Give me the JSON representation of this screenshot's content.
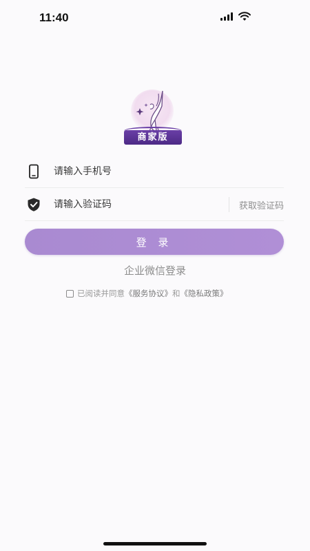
{
  "status_bar": {
    "time": "11:40"
  },
  "brand": {
    "badge": "商家版"
  },
  "form": {
    "phone_placeholder": "请输入手机号",
    "code_placeholder": "请输入验证码",
    "get_code_label": "获取验证码"
  },
  "actions": {
    "login_label": "登 录",
    "wechat_login_label": "企业微信登录"
  },
  "agreement": {
    "prefix": "已阅读并同意",
    "service_link": "《服务协议》",
    "joiner": "和",
    "privacy_link": "《隐私政策》"
  },
  "colors": {
    "accent": "#ad8dd4",
    "badge": "#5a3394",
    "background": "#fbfafc"
  }
}
